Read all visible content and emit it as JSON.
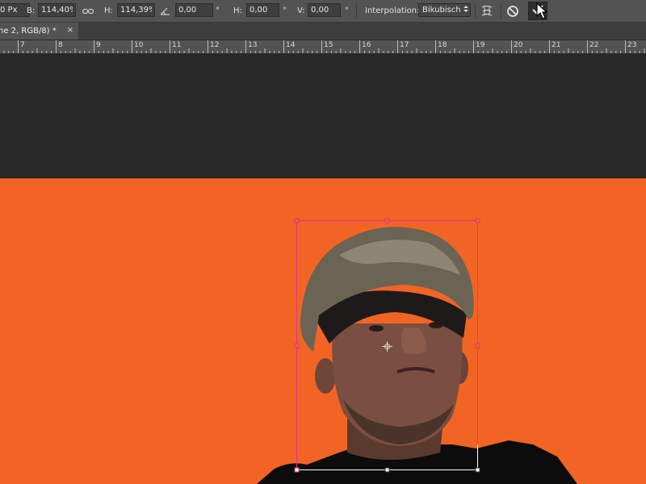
{
  "options_bar": {
    "x_value": "0 Px",
    "b_label": "B:",
    "b_value": "114,40%",
    "h_label": "H:",
    "h_value": "114,39%",
    "angle_value": "0,00",
    "angle_unit": "°",
    "skew_h_label": "H:",
    "skew_h_value": "0,00",
    "skew_h_unit": "°",
    "skew_v_label": "V:",
    "skew_v_value": "0,00",
    "skew_v_unit": "°",
    "interpolation_label": "Interpolation:",
    "interpolation_value": "Bikubisch"
  },
  "document_tab": {
    "title": "ne 2, RGB/8) *",
    "close": "×"
  },
  "ruler": {
    "numbers": [
      "7",
      "8",
      "9",
      "10",
      "11",
      "12",
      "13",
      "14",
      "15",
      "16",
      "17",
      "18",
      "19",
      "20",
      "21",
      "22",
      "23"
    ]
  },
  "canvas": {
    "background_color": "#f26424",
    "pasteboard_color": "#282828",
    "transform_box_color": "#e0338f"
  }
}
